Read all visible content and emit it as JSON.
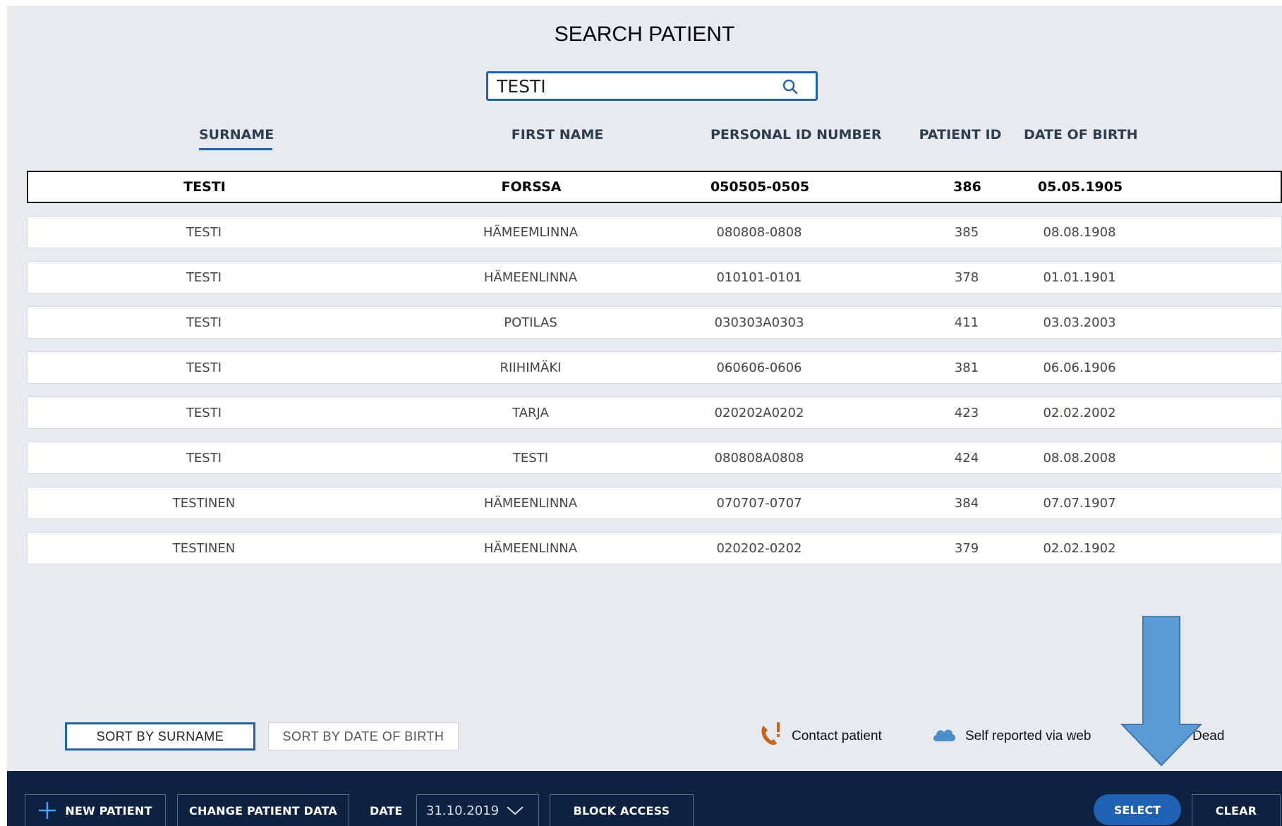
{
  "title": "SEARCH PATIENT",
  "search": {
    "value": "TESTI",
    "icon": "search-icon"
  },
  "columns": {
    "surname": "SURNAME",
    "first_name": "FIRST NAME",
    "personal_id": "PERSONAL ID NUMBER",
    "patient_id": "PATIENT ID",
    "dob": "DATE OF BIRTH"
  },
  "rows": [
    {
      "surname": "TESTI",
      "first_name": "FORSSA",
      "personal_id": "050505-0505",
      "patient_id": "386",
      "dob": "05.05.1905"
    },
    {
      "surname": "TESTI",
      "first_name": "HÄMEEMLINNA",
      "personal_id": "080808-0808",
      "patient_id": "385",
      "dob": "08.08.1908"
    },
    {
      "surname": "TESTI",
      "first_name": "HÄMEENLINNA",
      "personal_id": "010101-0101",
      "patient_id": "378",
      "dob": "01.01.1901"
    },
    {
      "surname": "TESTI",
      "first_name": "POTILAS",
      "personal_id": "030303A0303",
      "patient_id": "411",
      "dob": "03.03.2003"
    },
    {
      "surname": "TESTI",
      "first_name": "RIIHIMÄKI",
      "personal_id": "060606-0606",
      "patient_id": "381",
      "dob": "06.06.1906"
    },
    {
      "surname": "TESTI",
      "first_name": "TARJA",
      "personal_id": "020202A0202",
      "patient_id": "423",
      "dob": "02.02.2002"
    },
    {
      "surname": "TESTI",
      "first_name": "TESTI",
      "personal_id": "080808A0808",
      "patient_id": "424",
      "dob": "08.08.2008"
    },
    {
      "surname": "TESTINEN",
      "first_name": "HÄMEENLINNA",
      "personal_id": "070707-0707",
      "patient_id": "384",
      "dob": "07.07.1907"
    },
    {
      "surname": "TESTINEN",
      "first_name": "HÄMEENLINNA",
      "personal_id": "020202-0202",
      "patient_id": "379",
      "dob": "02.02.1902"
    }
  ],
  "sort": {
    "by_surname": "SORT BY SURNAME",
    "by_dob": "SORT BY DATE OF BIRTH"
  },
  "legend": {
    "contact": "Contact patient",
    "self_reported": "Self reported via web",
    "dead": "Dead"
  },
  "bottom": {
    "new_patient": "NEW PATIENT",
    "change_data": "CHANGE PATIENT DATA",
    "date_label": "DATE",
    "date_value": "31.10.2019",
    "block_access": "BLOCK ACCESS",
    "select": "SELECT",
    "clear": "CLEAR"
  },
  "colors": {
    "accent": "#1f62b3",
    "bar": "#0d2240",
    "background": "#e7ebef",
    "contact_icon": "#c7651c",
    "cloud_icon": "#4b8fc9",
    "annotation_arrow": "#5b9bd5"
  }
}
